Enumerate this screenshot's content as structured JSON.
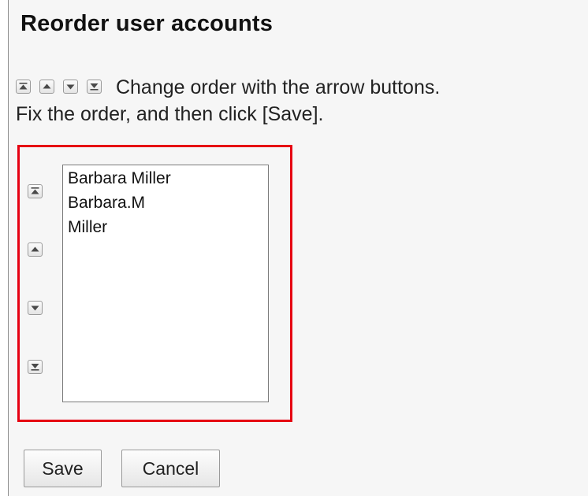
{
  "page": {
    "title": "Reorder user accounts"
  },
  "instructions": {
    "line1": "Change order with the arrow buttons.",
    "line2": "Fix the order, and then click [Save]."
  },
  "order_controls": {
    "icons": [
      "move-to-top-icon",
      "move-up-icon",
      "move-down-icon",
      "move-to-bottom-icon"
    ]
  },
  "user_list": {
    "items": [
      "Barbara Miller",
      "Barbara.M",
      "Miller"
    ]
  },
  "buttons": {
    "save_label": "Save",
    "cancel_label": "Cancel"
  },
  "colors": {
    "highlight_border": "#e60012",
    "panel_background": "#f6f6f6"
  }
}
